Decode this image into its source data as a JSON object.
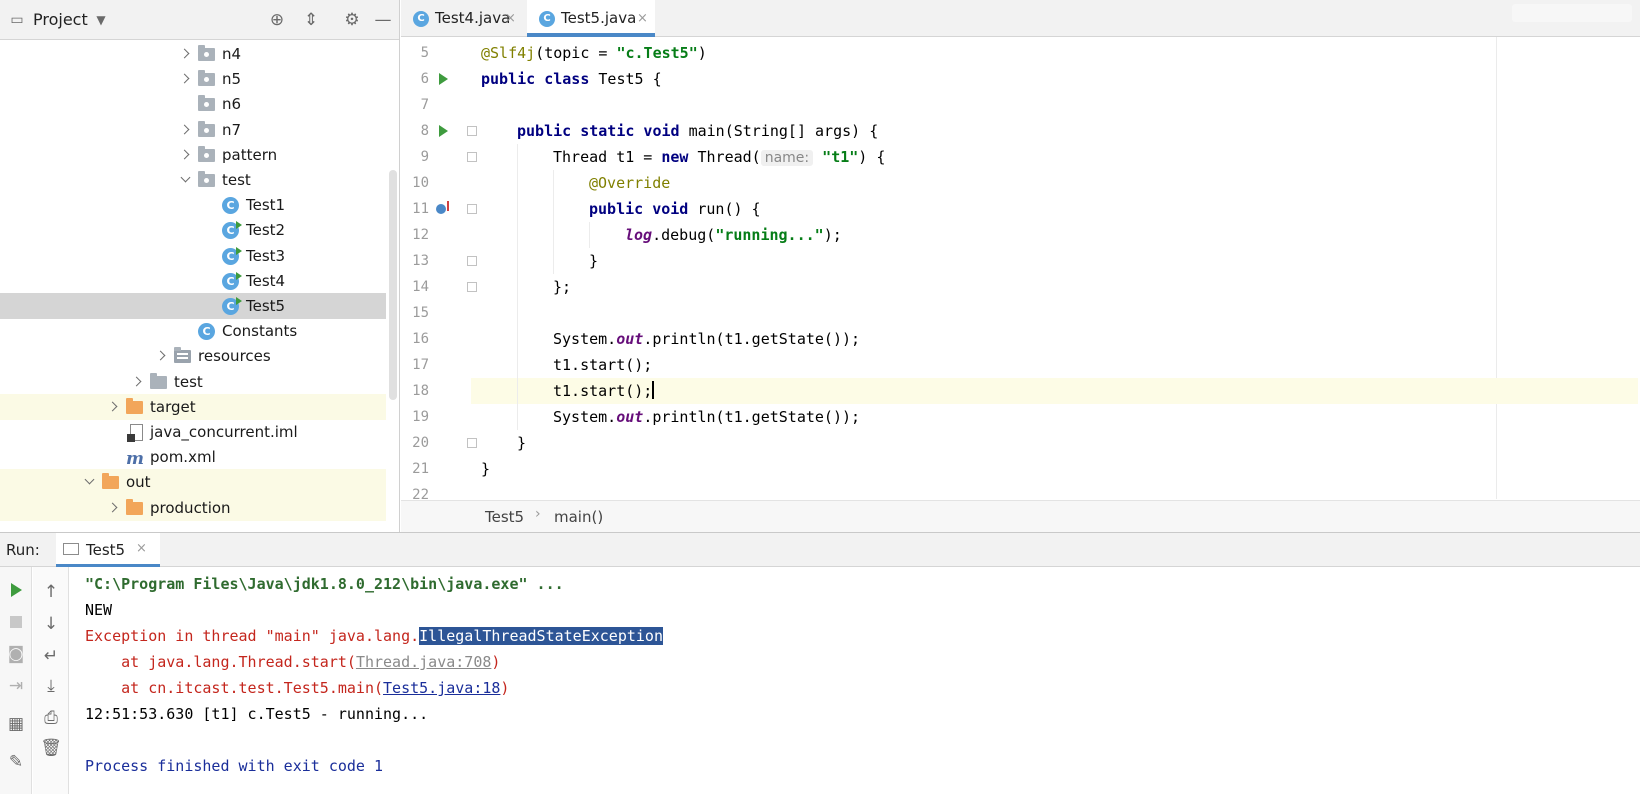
{
  "project": {
    "title": "Project",
    "tree": [
      {
        "label": "n4",
        "kind": "package",
        "arrow": "right",
        "indent": 1
      },
      {
        "label": "n5",
        "kind": "package",
        "arrow": "right",
        "indent": 1
      },
      {
        "label": "n6",
        "kind": "package",
        "arrow": "none",
        "indent": 1
      },
      {
        "label": "n7",
        "kind": "package",
        "arrow": "right",
        "indent": 1
      },
      {
        "label": "pattern",
        "kind": "package",
        "arrow": "right",
        "indent": 1
      },
      {
        "label": "test",
        "kind": "package",
        "arrow": "down",
        "indent": 1
      },
      {
        "label": "Test1",
        "kind": "class",
        "indent": 2
      },
      {
        "label": "Test2",
        "kind": "class-run",
        "indent": 2
      },
      {
        "label": "Test3",
        "kind": "class-run",
        "indent": 2
      },
      {
        "label": "Test4",
        "kind": "class-run",
        "indent": 2
      },
      {
        "label": "Test5",
        "kind": "class-run",
        "indent": 2,
        "selected": true
      },
      {
        "label": "Constants",
        "kind": "class",
        "indent": 1
      },
      {
        "label": "resources",
        "kind": "resources",
        "arrow": "right",
        "indent": 0
      },
      {
        "label": "test",
        "kind": "folder",
        "arrow": "right",
        "indent": -1
      },
      {
        "label": "target",
        "kind": "folder-orange",
        "arrow": "right",
        "indent": -2,
        "excluded": true
      },
      {
        "label": "java_concurrent.iml",
        "kind": "iml",
        "indent": -2
      },
      {
        "label": "pom.xml",
        "kind": "maven",
        "indent": -2
      },
      {
        "label": "out",
        "kind": "folder-orange",
        "arrow": "down",
        "indent": -3,
        "excluded": true
      },
      {
        "label": "production",
        "kind": "folder-orange",
        "arrow": "right",
        "indent": -2,
        "excluded": true
      }
    ]
  },
  "editor": {
    "tabs": [
      {
        "label": "Test4.java",
        "active": false
      },
      {
        "label": "Test5.java",
        "active": true
      }
    ],
    "close_glyph": "×",
    "line_numbers": [
      "5",
      "6",
      "7",
      "8",
      "9",
      "10",
      "11",
      "12",
      "13",
      "14",
      "15",
      "16",
      "17",
      "18",
      "19",
      "20",
      "21",
      "22"
    ],
    "code": {
      "l5": {
        "ann": "@Slf4j",
        "p1": "(topic = ",
        "s1": "\"c.Test5\"",
        "p2": ")"
      },
      "l6": {
        "kw": "public class",
        "p1": " Test5 {"
      },
      "l8": {
        "kw": "public static void",
        "p1": " main(String[] args) {"
      },
      "l9": {
        "p1": "Thread t1 = ",
        "kw": "new",
        "p2": " Thread(",
        "hint": "name:",
        "s1": "\"t1\"",
        "p3": ") {"
      },
      "l10": {
        "ann": "@Override"
      },
      "l11": {
        "kw": "public void",
        "p1": " run() {"
      },
      "l12": {
        "field": "log",
        "p1": ".debug(",
        "s1": "\"running...\"",
        "p2": ");"
      },
      "l13": {
        "p1": "}"
      },
      "l14": {
        "p1": "};"
      },
      "l16": {
        "p1": "System.",
        "field": "out",
        "p2": ".println(t1.getState());"
      },
      "l17": {
        "p1": "t1.start();"
      },
      "l18": {
        "p1": "t1.start();"
      },
      "l19": {
        "p1": "System.",
        "field": "out",
        "p2": ".println(t1.getState());"
      },
      "l20": {
        "p1": "}"
      },
      "l21": {
        "p1": "}"
      }
    },
    "breadcrumb": {
      "class": "Test5",
      "sep": "›",
      "method": "main()"
    }
  },
  "run": {
    "label": "Run:",
    "tab_label": "Test5",
    "tab_close": "×",
    "console": {
      "cmd": "\"C:\\Program Files\\Java\\jdk1.8.0_212\\bin\\java.exe\" ...",
      "new_state": "NEW",
      "exc_prefix": "Exception in thread \"main\" java.lang.",
      "exc_selected": "IllegalThreadStateException",
      "trace1_prefix": "    at java.lang.Thread.start(",
      "trace1_link": "Thread.java:708",
      "trace1_suffix": ")",
      "trace2_prefix": "    at cn.itcast.test.Test5.main(",
      "trace2_link": "Test5.java:18",
      "trace2_suffix": ")",
      "log_line": "12:51:53.630 [t1] c.Test5 - running...",
      "exit_line": "Process finished with exit code 1"
    }
  }
}
